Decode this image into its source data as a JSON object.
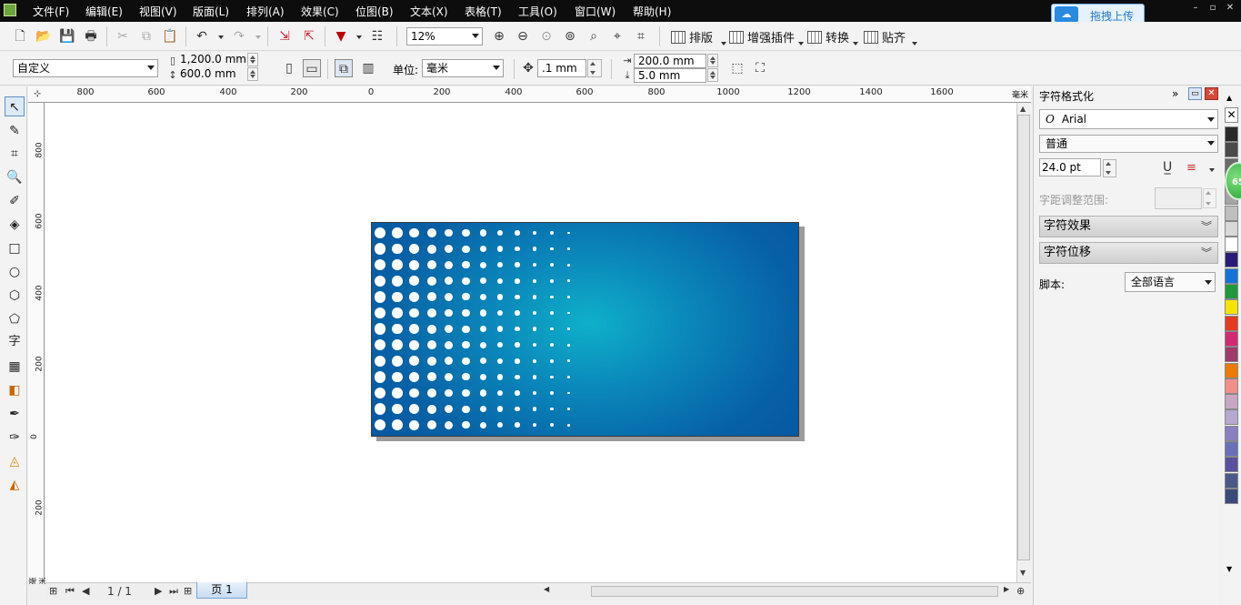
{
  "menubar": {
    "items": [
      "文件(F)",
      "编辑(E)",
      "视图(V)",
      "版面(L)",
      "排列(A)",
      "效果(C)",
      "位图(B)",
      "文本(X)",
      "表格(T)",
      "工具(O)",
      "窗口(W)",
      "帮助(H)"
    ],
    "upload_label": "拖拽上传",
    "cloud_icon": "cloud-icon"
  },
  "toolbar": {
    "zoom": "12%",
    "layout_label": "排版",
    "plugin_label": "增强插件",
    "convert_label": "转换",
    "snap_label": "贴齐"
  },
  "propbar": {
    "preset": "自定义",
    "width": "1,200.0 mm",
    "height": "600.0 mm",
    "unit_label": "单位:",
    "unit": "毫米",
    "nudge": ".1 mm",
    "dup_x": "200.0 mm",
    "dup_y": "5.0 mm"
  },
  "ruler": {
    "h_labels": [
      "800",
      "600",
      "400",
      "200",
      "0",
      "200",
      "400",
      "600",
      "800",
      "1000",
      "1200",
      "1400",
      "1600"
    ],
    "v_labels": [
      "800",
      "600",
      "400",
      "200",
      "0",
      "200"
    ],
    "unit_h": "毫米",
    "unit_v": "毫米"
  },
  "pager": {
    "page_count": "1 / 1",
    "page_tab": "页 1"
  },
  "docker": {
    "title": "字符格式化",
    "font": "Arial",
    "style": "普通",
    "size": "24.0 pt",
    "kerning_label": "字距调整范围:",
    "effects_label": "字符效果",
    "shift_label": "字符位移",
    "script_label": "脚本:",
    "script_value": "全部语言"
  },
  "palette": {
    "colors": [
      "#2a2a2a",
      "#4a4a4a",
      "#6b6b6b",
      "#8a8a8a",
      "#a5a5a5",
      "#bfbfbf",
      "#d8d8d8",
      "#ffffff",
      "#2b1a7a",
      "#1473d8",
      "#1f9a3a",
      "#f5e400",
      "#e53a1e",
      "#d42a74",
      "#a03a6a",
      "#ee7a00",
      "#f38f8a",
      "#c8a6c4",
      "#b6a8d0",
      "#8a80c0",
      "#6a70b8",
      "#5a50a0",
      "#4a5a88",
      "#3a4a7a"
    ],
    "badge": "65"
  }
}
